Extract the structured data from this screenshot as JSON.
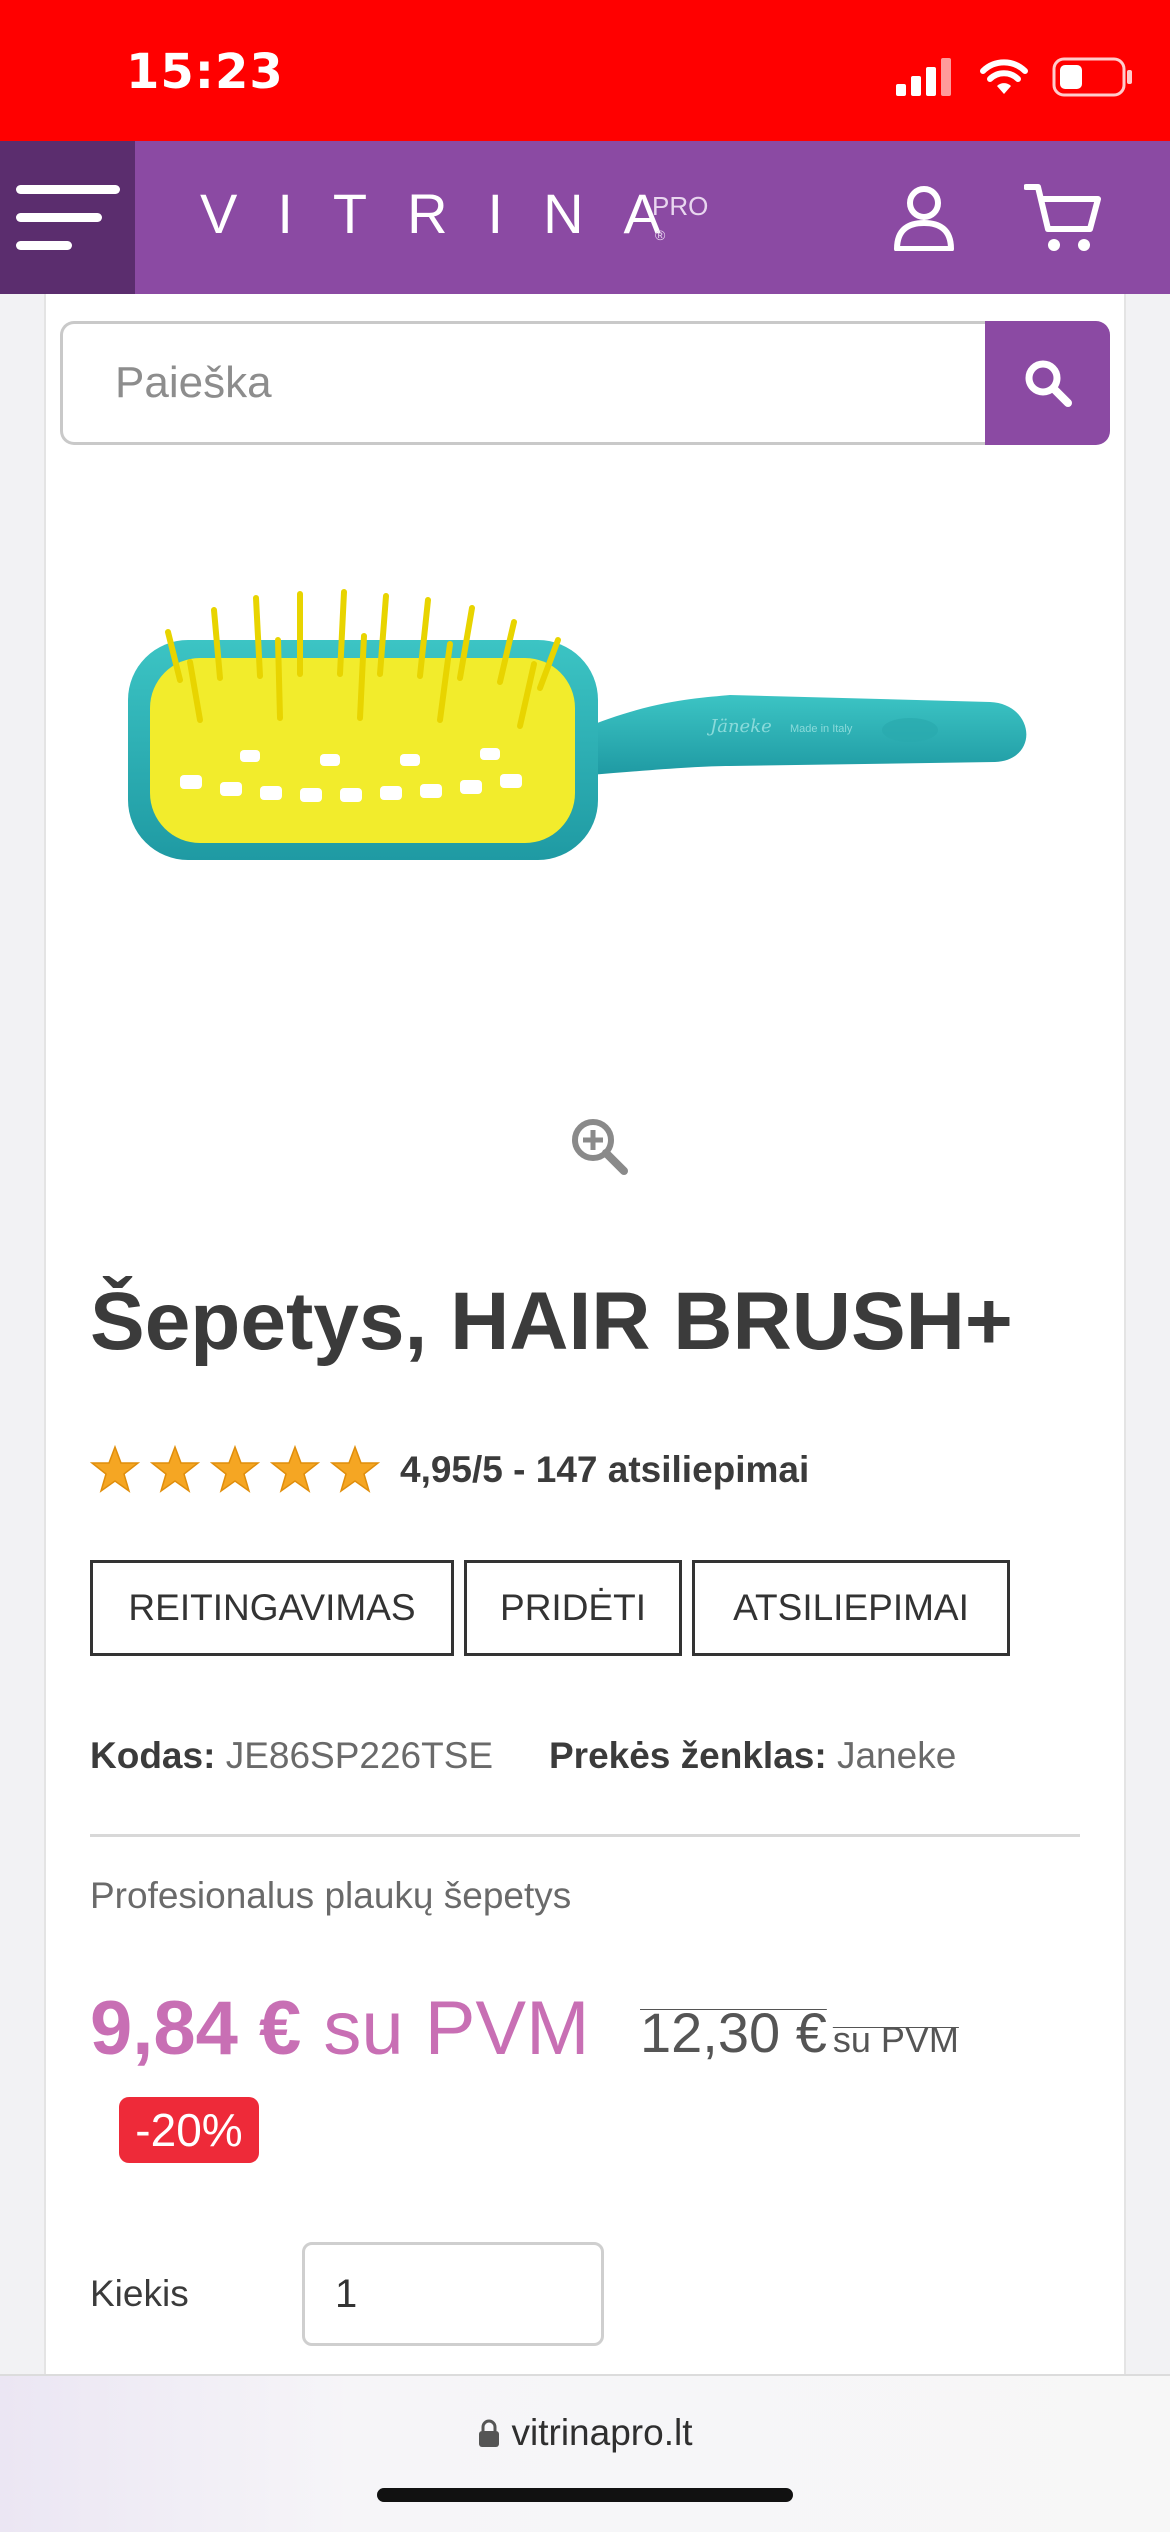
{
  "status_bar": {
    "time": "15:23"
  },
  "header": {
    "logo": "VITRINA",
    "logo_pro": "PRO",
    "logo_reg": "®"
  },
  "search": {
    "placeholder": "Paieška"
  },
  "product": {
    "title": "Šepetys, HAIR BRUSH+",
    "rating_text": "4,95/5 - 147 atsiliepimai",
    "rating_value": 4.95,
    "rating_max": 5,
    "tabs": [
      "REITINGAVIMAS",
      "PRIDĖTI",
      "ATSILIEPIMAI"
    ],
    "code_label": "Kodas:",
    "code_value": "JE86SP226TSE",
    "brand_label": "Prekės ženklas:",
    "brand_value": "Janeke",
    "description": "Profesionalus plaukų šepetys",
    "price_now": "9,84 €",
    "price_now_vat": "su PVM",
    "price_old": "12,30 €",
    "price_old_vat": "su PVM",
    "discount": "-20%",
    "quantity_label": "Kiekis",
    "quantity_value": "1"
  },
  "browser": {
    "url": "vitrinapro.lt"
  },
  "colors": {
    "status_bar": "#ff0000",
    "brand_purple": "#8b4aa3",
    "menu_dark": "#5b2d6e",
    "price_pink": "#c86fb4",
    "discount_red": "#ee2a39",
    "star_orange": "#f5a623"
  }
}
